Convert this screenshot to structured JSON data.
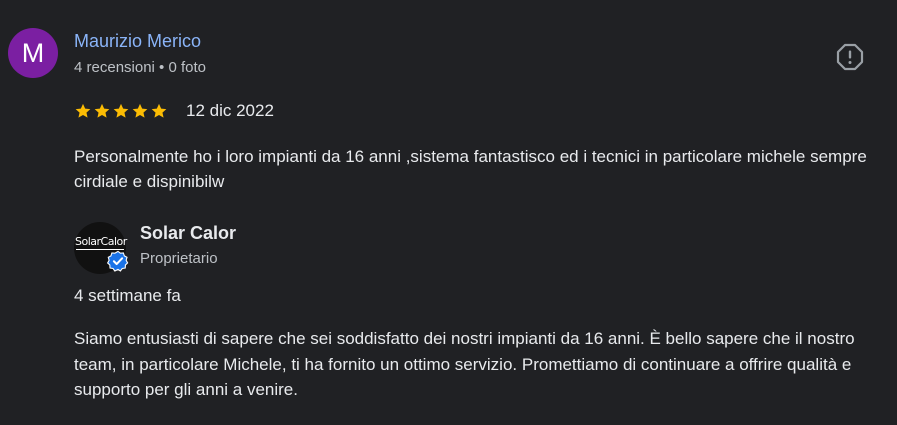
{
  "review": {
    "author": {
      "initial": "M",
      "name": "Maurizio Merico",
      "meta": "4 recensioni • 0 foto",
      "avatar_color": "#7b1fa2"
    },
    "rating": {
      "stars": 5,
      "max": 5,
      "star_color": "#fbbc04",
      "date": "12 dic 2022"
    },
    "text": "Personalmente ho i loro impianti da 16 anni ,sistema fantastisco ed i tecnici in particolare michele sempre cirdiale e dispinibilw",
    "report_icon": "report-flag-icon"
  },
  "owner_response": {
    "logo_text": "SolarCalor",
    "name": "Solar Calor",
    "role": "Proprietario",
    "verified_icon": "verified-badge-icon",
    "verified_color": "#1a73e8",
    "time": "4 settimane fa",
    "text": "Siamo entusiasti di sapere che sei soddisfatto dei nostri impianti da 16 anni. È bello sapere che il nostro team, in particolare Michele, ti ha fornito un ottimo servizio. Promettiamo di continuare a offrire qualità e supporto per gli anni a venire."
  }
}
